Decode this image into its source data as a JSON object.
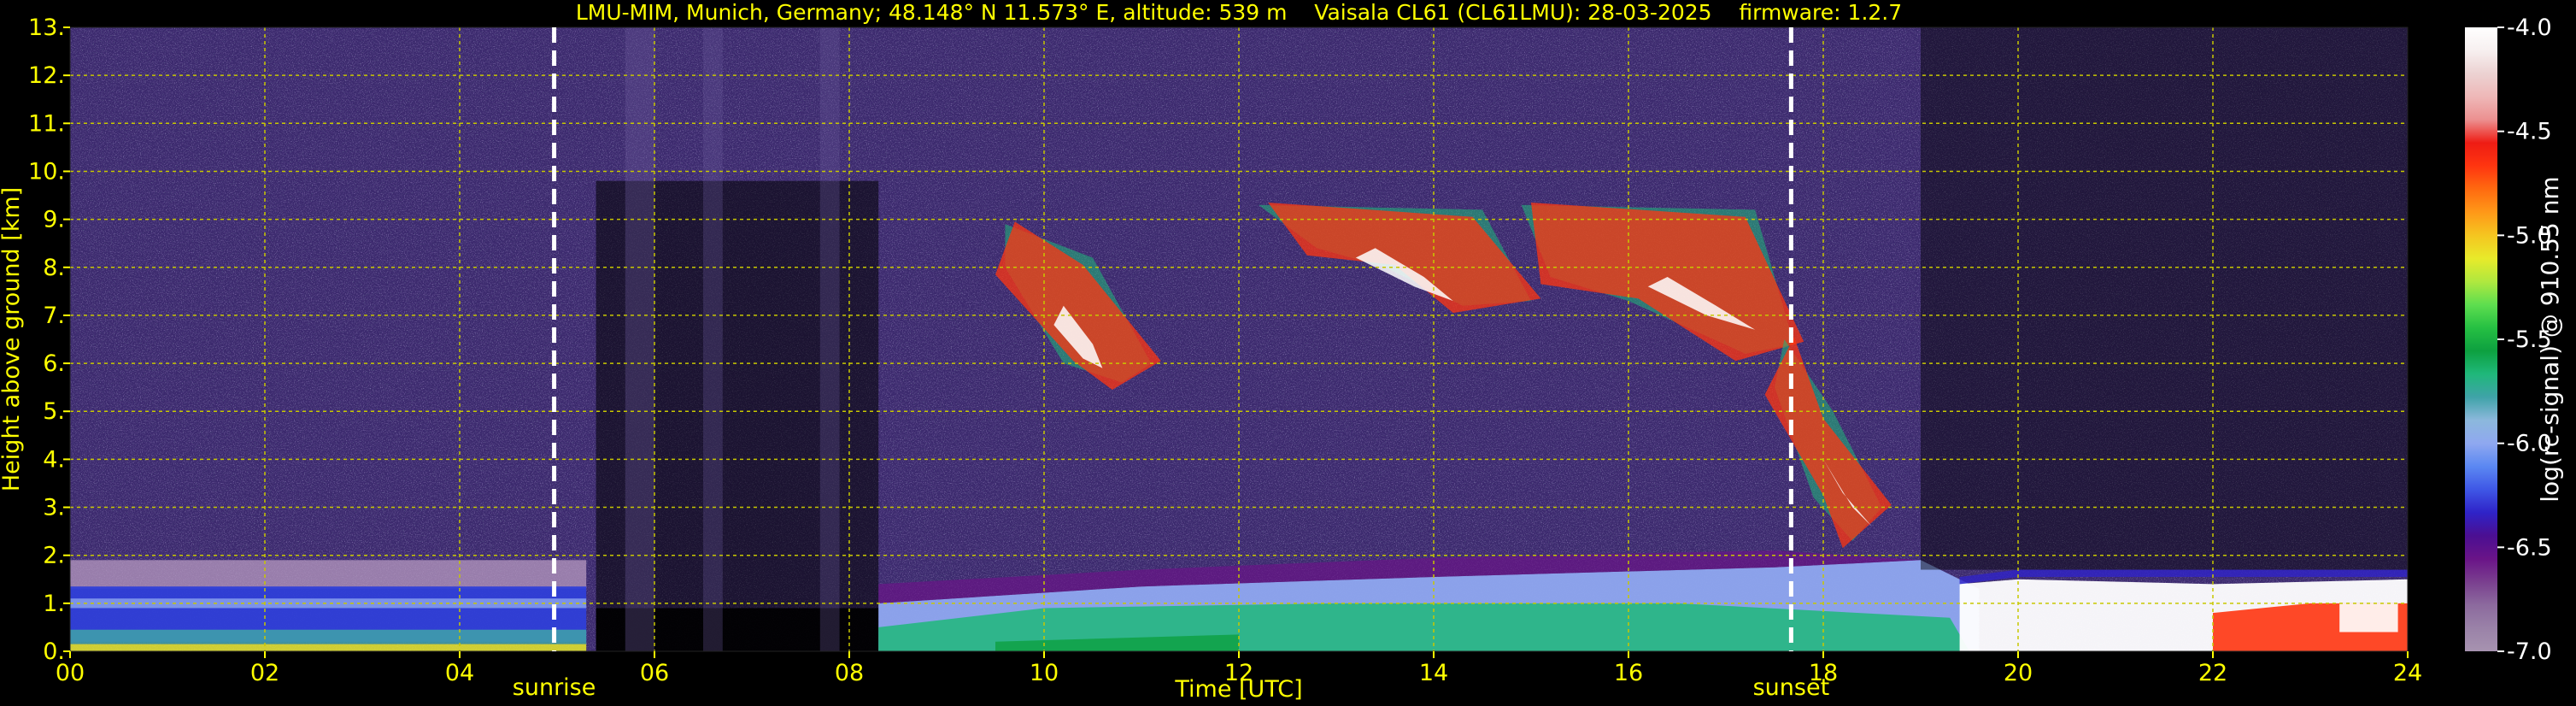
{
  "chart_data": {
    "type": "heatmap",
    "title": "LMU-MIM, Munich, Germany; 48.148° N 11.573° E, altitude: 539 m    Vaisala CL61 (CL61LMU): 28-03-2025    firmware: 1.2.7",
    "xlabel": "Time [UTC]",
    "ylabel": "Height above ground [km]",
    "colorbar_label": "log(rc-signal) @ 910.55 nm",
    "xlim": [
      0,
      24
    ],
    "ylim": [
      0,
      13
    ],
    "xtick_labels": [
      "00",
      "02",
      "04",
      "06",
      "08",
      "10",
      "12",
      "14",
      "16",
      "18",
      "20",
      "22",
      "24"
    ],
    "xtick_values": [
      0,
      2,
      4,
      6,
      8,
      10,
      12,
      14,
      16,
      18,
      20,
      22,
      24
    ],
    "ytick_labels": [
      "0.",
      "1.",
      "2.",
      "3.",
      "4.",
      "5.",
      "6.",
      "7.",
      "8.",
      "9.",
      "10.",
      "11.",
      "12.",
      "13."
    ],
    "ytick_values": [
      0,
      1,
      2,
      3,
      4,
      5,
      6,
      7,
      8,
      9,
      10,
      11,
      12,
      13
    ],
    "colorbar_range": [
      -7.0,
      -4.0
    ],
    "colorbar_tick_labels": [
      "-4.0",
      "-4.5",
      "-5.0",
      "-5.5",
      "-6.0",
      "-6.5",
      "-7.0"
    ],
    "colorbar_tick_values": [
      -4.0,
      -4.5,
      -5.0,
      -5.5,
      -6.0,
      -6.5,
      -7.0
    ],
    "grid": true,
    "events": [
      {
        "label": "sunrise",
        "time": 4.97
      },
      {
        "label": "sunset",
        "time": 17.67
      }
    ],
    "colors": {
      "text": "#ffff00",
      "background": "#000000",
      "grid": "#c8c800",
      "event_line": "#ffffff",
      "noise": "#3c2a6e"
    },
    "colormap": [
      "#a793b0",
      "#9a82a8",
      "#8c6a9e",
      "#7a3f8f",
      "#6a1488",
      "#4b0f92",
      "#2f23c8",
      "#3f57e6",
      "#5b88f2",
      "#8fa8f0",
      "#8cb8dc",
      "#3fa3a8",
      "#1fb87a",
      "#0da040",
      "#26c043",
      "#5ede4f",
      "#b0e83f",
      "#e8ea2a",
      "#f5c520",
      "#ff9818",
      "#ff6a10",
      "#ff3510",
      "#ee1c14",
      "#ec9090",
      "#eeb8b8",
      "#ecd2d2",
      "#f7f0f0",
      "#ffffff"
    ]
  }
}
